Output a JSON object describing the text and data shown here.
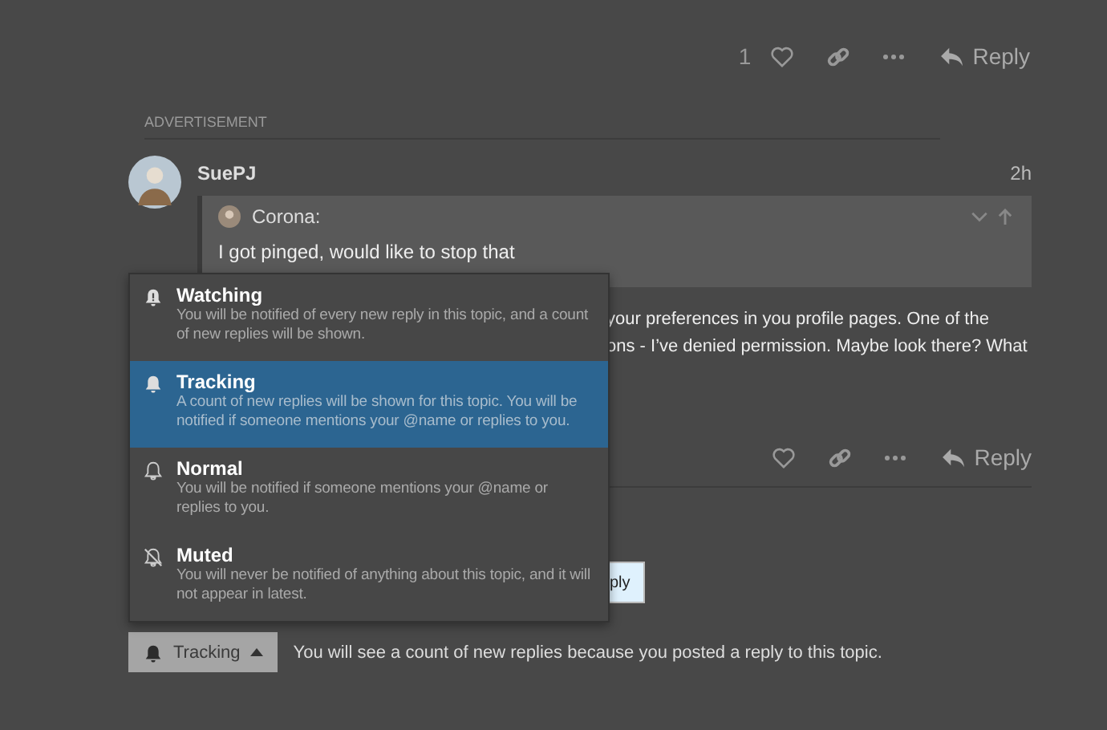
{
  "top_actions": {
    "like_count": "1",
    "reply_label": "Reply"
  },
  "advertisement_label": "ADVERTISEMENT",
  "post": {
    "author": "SuePJ",
    "time": "2h",
    "quote": {
      "author": "Corona:",
      "text": "I got pinged, would like to stop that"
    },
    "body_lines": [
      "your preferences in you profile pages. One of the",
      "ons - I’ve denied permission. Maybe look there? What"
    ],
    "reply_label": "Reply"
  },
  "reply_button_fragment": "ply",
  "notification_menu": {
    "items": [
      {
        "kind": "watching",
        "title": "Watching",
        "description": "You will be notified of every new reply in this topic, and a count of new replies will be shown.",
        "selected": false
      },
      {
        "kind": "tracking",
        "title": "Tracking",
        "description": "A count of new replies will be shown for this topic. You will be notified if someone mentions your @name or replies to you.",
        "selected": true
      },
      {
        "kind": "normal",
        "title": "Normal",
        "description": "You will be notified if someone mentions your @name or replies to you.",
        "selected": false
      },
      {
        "kind": "muted",
        "title": "Muted",
        "description": "You will never be notified of anything about this topic, and it will not appear in latest.",
        "selected": false
      }
    ]
  },
  "notification_button": {
    "label": "Tracking",
    "expanded": true
  },
  "notification_reason": "You will see a count of new replies because you posted a reply to this topic."
}
